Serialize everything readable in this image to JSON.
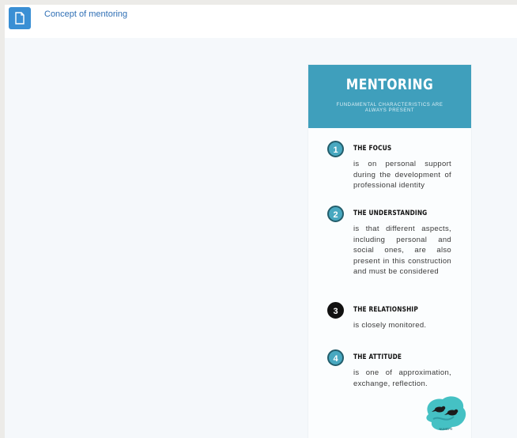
{
  "topbar": {
    "icon": "file-icon",
    "link_label": "Concept of mentoring"
  },
  "poster": {
    "title": "MENTORING",
    "subtitle": "FUNDAMENTAL CHARACTERISTICS ARE ALWAYS PRESENT",
    "accent_color": "#3f9fbc",
    "items": [
      {
        "number": "1",
        "title": "THE FOCUS",
        "text": "is on personal support during the development of professional identity"
      },
      {
        "number": "2",
        "title": "THE UNDERSTANDING",
        "text": "is that different aspects, including personal and social ones, are also present in this construction and must be considered"
      },
      {
        "number": "3",
        "title": "THE RELATIONSHIP",
        "text": "is closely monitored."
      },
      {
        "number": "4",
        "title": "THE ATTITUDE",
        "text": "is one of approximation, exchange, reflection."
      }
    ],
    "logo_text": "NUMEPE"
  }
}
